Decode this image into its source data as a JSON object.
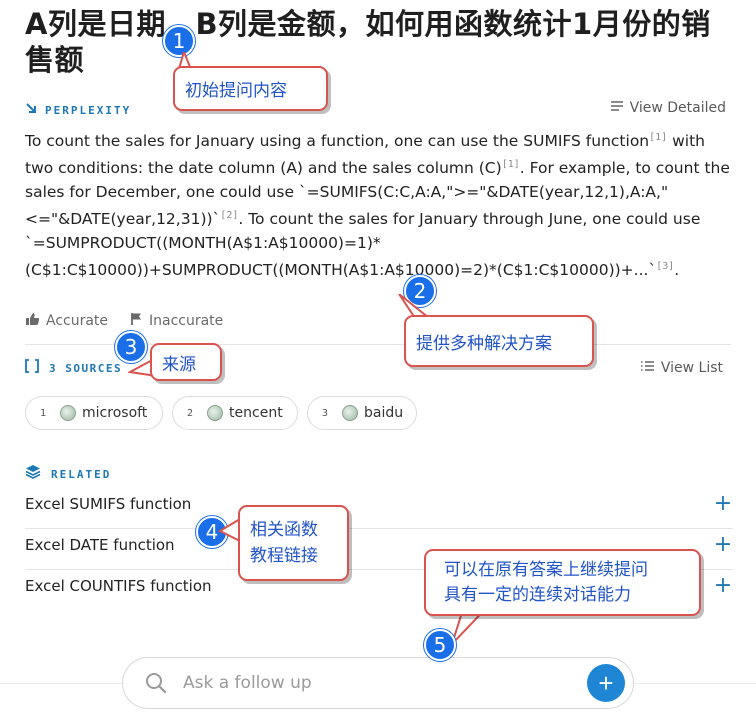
{
  "title": "A列是日期，B列是金额，如何用函数统计1月份的销售额",
  "brand": {
    "label": "PERPLEXITY",
    "icon": "arrow-down-right-icon"
  },
  "view_detailed": "View Detailed",
  "answer": {
    "p1": "To count the sales for January using a function, one can use the SUMIFS function",
    "c1": "[1]",
    "p2": " with two conditions: the date column (A) and the sales column (C)",
    "c2": "[1]",
    "p3": ". For example, to count the sales for December, one could use `=SUMIFS(C:C,A:A,\">=\"&DATE(year,12,1),A:A,\"<=\"&DATE(year,12,31))`",
    "c3": "[2]",
    "p4": ". To count the sales for January through June, one could use `=SUMPRODUCT((MONTH(A$1:A$10000)=1)*(C$1:C$10000))+SUMPRODUCT((MONTH(A$1:A$10000)=2)*(C$1:C$10000))+...`",
    "c4": "[3]",
    "p5": "."
  },
  "feedback": {
    "accurate": "Accurate",
    "inaccurate": "Inaccurate"
  },
  "sources": {
    "label": "3 SOURCES",
    "view_list": "View List",
    "items": [
      {
        "num": "1",
        "name": "microsoft"
      },
      {
        "num": "2",
        "name": "tencent"
      },
      {
        "num": "3",
        "name": "baidu"
      }
    ]
  },
  "related": {
    "label": "RELATED",
    "items": [
      "Excel SUMIFS function",
      "Excel DATE function",
      "Excel COUNTIFS function"
    ]
  },
  "ask": {
    "placeholder": "Ask a follow up"
  },
  "annotations": [
    {
      "num": "1",
      "text": "初始提问内容"
    },
    {
      "num": "2",
      "text": "提供多种解决方案"
    },
    {
      "num": "3",
      "text": "来源"
    },
    {
      "num": "4",
      "text1": "相关函数",
      "text2": "教程链接"
    },
    {
      "num": "5",
      "text1": "可以在原有答案上继续提问",
      "text2": "具有一定的连续对话能力"
    }
  ],
  "colors": {
    "accent": "#1e78b4",
    "badge": "#1a6fe8",
    "callout_border": "#d9534f",
    "callout_text": "#2154c7"
  }
}
